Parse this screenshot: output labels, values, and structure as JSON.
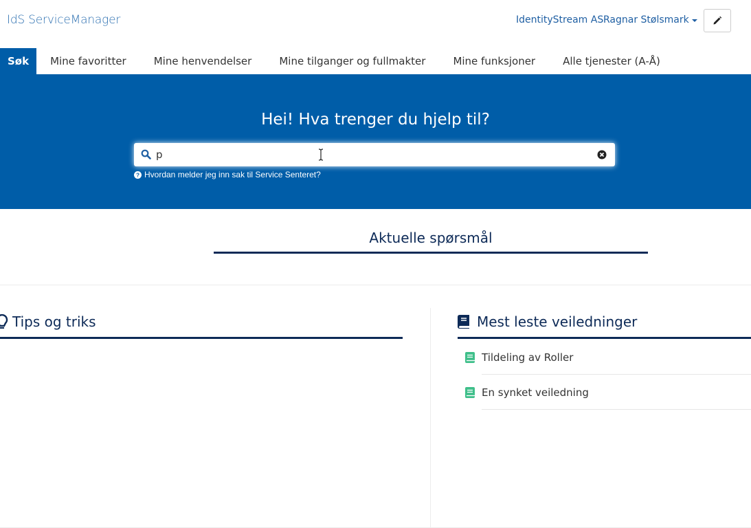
{
  "header": {
    "brand": "IdS ServiceManager",
    "organization": "IdentityStream AS",
    "user_name": "Ragnar Stølsmark"
  },
  "tabs": [
    {
      "label": "Søk",
      "active": true
    },
    {
      "label": "Mine favoritter"
    },
    {
      "label": "Mine henvendelser"
    },
    {
      "label": "Mine tilganger og fullmakter"
    },
    {
      "label": "Mine funksjoner"
    },
    {
      "label": "Alle tjenester (A-Å)"
    }
  ],
  "hero": {
    "title": "Hei! Hva trenger du hjelp til?",
    "search_value": "p",
    "help_link": "Hvordan melder jeg inn sak til Service Senteret?"
  },
  "current_questions": {
    "title": "Aktuelle spørsmål"
  },
  "tips": {
    "title": "Tips og triks"
  },
  "guides": {
    "title": "Mest leste veiledninger",
    "items": [
      {
        "label": "Tildeling av Roller"
      },
      {
        "label": "En synket veiledning"
      }
    ]
  },
  "colors": {
    "primary": "#005da8",
    "heading": "#0d2a57",
    "link": "#1f5fa3",
    "guide_icon": "#3fbf8a"
  },
  "icons": {
    "edit": "pencil-icon",
    "search": "search-icon",
    "clear": "clear-icon",
    "help": "question-circle-icon",
    "tips": "lightbulb-icon",
    "guides": "book-icon",
    "guide_item": "book-icon"
  }
}
